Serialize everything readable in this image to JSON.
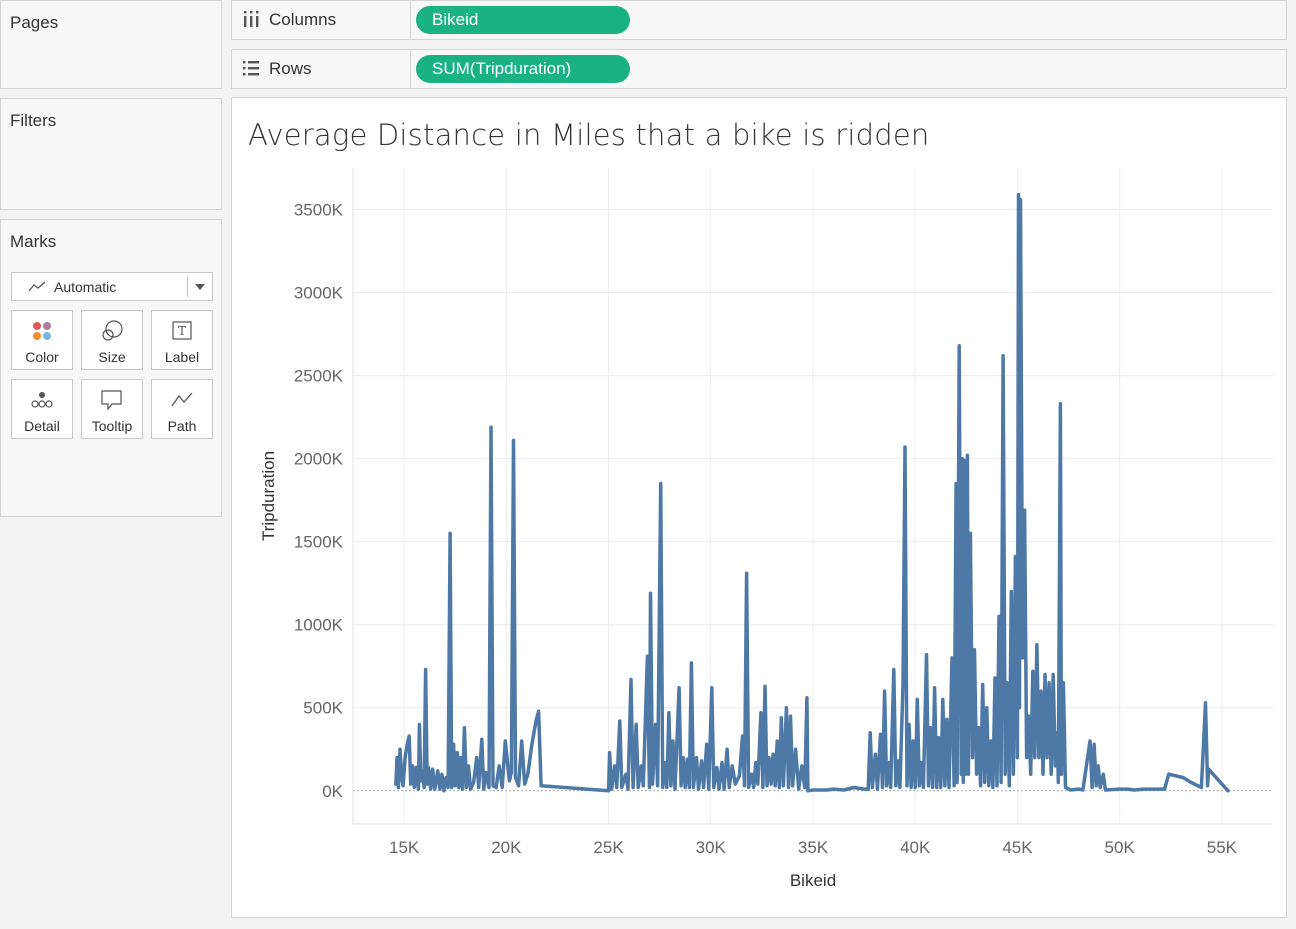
{
  "panels": {
    "pages": {
      "title": "Pages"
    },
    "filters": {
      "title": "Filters"
    },
    "marks": {
      "title": "Marks",
      "mark_type": "Automatic",
      "cards": [
        {
          "label": "Color",
          "icon": "color-icon"
        },
        {
          "label": "Size",
          "icon": "size-icon"
        },
        {
          "label": "Label",
          "icon": "label-icon"
        },
        {
          "label": "Detail",
          "icon": "detail-icon"
        },
        {
          "label": "Tooltip",
          "icon": "tooltip-icon"
        },
        {
          "label": "Path",
          "icon": "path-icon"
        }
      ]
    }
  },
  "shelves": {
    "columns": {
      "label": "Columns",
      "icon": "columns-icon",
      "pill": "Bikeid"
    },
    "rows": {
      "label": "Rows",
      "icon": "rows-icon",
      "pill": "SUM(Tripduration)"
    }
  },
  "colors": {
    "pill": "#1ab283",
    "line": "#4e79a7"
  },
  "chart_data": {
    "type": "line",
    "title": "Average Distance in Miles that a bike is ridden",
    "xlabel": "Bikeid",
    "ylabel": "Tripduration",
    "xlim": [
      12500,
      57500
    ],
    "ylim": [
      -200000,
      3750000
    ],
    "x_ticks": [
      15000,
      20000,
      25000,
      30000,
      35000,
      40000,
      45000,
      50000,
      55000
    ],
    "x_tick_labels": [
      "15K",
      "20K",
      "25K",
      "30K",
      "35K",
      "40K",
      "45K",
      "50K",
      "55K"
    ],
    "y_ticks": [
      0,
      500000,
      1000000,
      1500000,
      2000000,
      2500000,
      3000000,
      3500000
    ],
    "y_tick_labels": [
      "0K",
      "500K",
      "1000K",
      "1500K",
      "2000K",
      "2500K",
      "3000K",
      "3500K"
    ],
    "grid": true,
    "series": [
      {
        "points": [
          [
            14600,
            40000
          ],
          [
            14650,
            200000
          ],
          [
            14720,
            20000
          ],
          [
            14800,
            250000
          ],
          [
            14880,
            80000
          ],
          [
            14950,
            30000
          ],
          [
            15050,
            200000
          ],
          [
            15150,
            280000
          ],
          [
            15250,
            330000
          ],
          [
            15320,
            40000
          ],
          [
            15420,
            150000
          ],
          [
            15500,
            20000
          ],
          [
            15600,
            140000
          ],
          [
            15700,
            10000
          ],
          [
            15750,
            400000
          ],
          [
            15820,
            60000
          ],
          [
            15900,
            120000
          ],
          [
            15980,
            20000
          ],
          [
            16050,
            730000
          ],
          [
            16130,
            40000
          ],
          [
            16200,
            140000
          ],
          [
            16300,
            10000
          ],
          [
            16400,
            130000
          ],
          [
            16500,
            10000
          ],
          [
            16650,
            120000
          ],
          [
            16750,
            10000
          ],
          [
            16850,
            100000
          ],
          [
            16950,
            0
          ],
          [
            17050,
            80000
          ],
          [
            17150,
            20000
          ],
          [
            17250,
            1550000
          ],
          [
            17330,
            20000
          ],
          [
            17420,
            280000
          ],
          [
            17500,
            30000
          ],
          [
            17600,
            230000
          ],
          [
            17680,
            20000
          ],
          [
            17780,
            200000
          ],
          [
            17860,
            10000
          ],
          [
            17950,
            380000
          ],
          [
            18050,
            20000
          ],
          [
            18150,
            150000
          ],
          [
            18250,
            10000
          ],
          [
            18400,
            50000
          ],
          [
            18550,
            200000
          ],
          [
            18650,
            20000
          ],
          [
            18800,
            310000
          ],
          [
            18900,
            10000
          ],
          [
            19000,
            110000
          ],
          [
            19150,
            20000
          ],
          [
            19250,
            2190000
          ],
          [
            19350,
            30000
          ],
          [
            19500,
            20000
          ],
          [
            19650,
            150000
          ],
          [
            19800,
            20000
          ],
          [
            19950,
            300000
          ],
          [
            20150,
            60000
          ],
          [
            20250,
            110000
          ],
          [
            20350,
            2110000
          ],
          [
            20450,
            80000
          ],
          [
            20600,
            30000
          ],
          [
            20750,
            300000
          ],
          [
            20900,
            40000
          ],
          [
            21050,
            100000
          ],
          [
            21250,
            280000
          ],
          [
            21450,
            420000
          ],
          [
            21580,
            480000
          ],
          [
            21700,
            30000
          ],
          [
            25000,
            0
          ],
          [
            25050,
            230000
          ],
          [
            25150,
            10000
          ],
          [
            25300,
            150000
          ],
          [
            25400,
            20000
          ],
          [
            25550,
            420000
          ],
          [
            25650,
            20000
          ],
          [
            25850,
            100000
          ],
          [
            25950,
            10000
          ],
          [
            26100,
            670000
          ],
          [
            26200,
            20000
          ],
          [
            26350,
            400000
          ],
          [
            26450,
            20000
          ],
          [
            26600,
            150000
          ],
          [
            26700,
            30000
          ],
          [
            26900,
            810000
          ],
          [
            27000,
            20000
          ],
          [
            27050,
            1190000
          ],
          [
            27150,
            40000
          ],
          [
            27300,
            400000
          ],
          [
            27400,
            30000
          ],
          [
            27550,
            1850000
          ],
          [
            27650,
            20000
          ],
          [
            27750,
            170000
          ],
          [
            27850,
            20000
          ],
          [
            27950,
            470000
          ],
          [
            28050,
            30000
          ],
          [
            28150,
            300000
          ],
          [
            28250,
            10000
          ],
          [
            28450,
            620000
          ],
          [
            28550,
            30000
          ],
          [
            28650,
            200000
          ],
          [
            28750,
            20000
          ],
          [
            28850,
            190000
          ],
          [
            28950,
            20000
          ],
          [
            29050,
            770000
          ],
          [
            29150,
            20000
          ],
          [
            29300,
            200000
          ],
          [
            29400,
            10000
          ],
          [
            29550,
            180000
          ],
          [
            29650,
            20000
          ],
          [
            29800,
            280000
          ],
          [
            29900,
            10000
          ],
          [
            30050,
            620000
          ],
          [
            30150,
            20000
          ],
          [
            30300,
            140000
          ],
          [
            30400,
            10000
          ],
          [
            30550,
            170000
          ],
          [
            30650,
            10000
          ],
          [
            30800,
            250000
          ],
          [
            30900,
            20000
          ],
          [
            31050,
            150000
          ],
          [
            31200,
            40000
          ],
          [
            31400,
            90000
          ],
          [
            31550,
            330000
          ],
          [
            31650,
            30000
          ],
          [
            31750,
            1310000
          ],
          [
            31850,
            20000
          ],
          [
            32000,
            100000
          ],
          [
            32100,
            20000
          ],
          [
            32200,
            170000
          ],
          [
            32300,
            40000
          ],
          [
            32450,
            470000
          ],
          [
            32550,
            20000
          ],
          [
            32650,
            630000
          ],
          [
            32750,
            30000
          ],
          [
            32850,
            200000
          ],
          [
            32950,
            40000
          ],
          [
            33050,
            220000
          ],
          [
            33150,
            30000
          ],
          [
            33250,
            300000
          ],
          [
            33350,
            20000
          ],
          [
            33450,
            440000
          ],
          [
            33550,
            30000
          ],
          [
            33700,
            500000
          ],
          [
            33800,
            20000
          ],
          [
            33900,
            450000
          ],
          [
            34000,
            30000
          ],
          [
            34150,
            250000
          ],
          [
            34300,
            10000
          ],
          [
            34450,
            150000
          ],
          [
            34600,
            20000
          ],
          [
            34700,
            560000
          ],
          [
            34750,
            0
          ],
          [
            35000,
            5000
          ],
          [
            35700,
            5000
          ],
          [
            36000,
            10000
          ],
          [
            36500,
            5000
          ],
          [
            37000,
            20000
          ],
          [
            37500,
            10000
          ],
          [
            37700,
            10000
          ],
          [
            37800,
            350000
          ],
          [
            37900,
            20000
          ],
          [
            38050,
            220000
          ],
          [
            38150,
            10000
          ],
          [
            38300,
            340000
          ],
          [
            38400,
            20000
          ],
          [
            38500,
            600000
          ],
          [
            38600,
            30000
          ],
          [
            38700,
            170000
          ],
          [
            38800,
            20000
          ],
          [
            38950,
            730000
          ],
          [
            39050,
            30000
          ],
          [
            39150,
            180000
          ],
          [
            39250,
            20000
          ],
          [
            39400,
            640000
          ],
          [
            39500,
            2070000
          ],
          [
            39600,
            30000
          ],
          [
            39700,
            400000
          ],
          [
            39800,
            20000
          ],
          [
            39900,
            300000
          ],
          [
            40000,
            20000
          ],
          [
            40100,
            550000
          ],
          [
            40200,
            30000
          ],
          [
            40300,
            170000
          ],
          [
            40400,
            20000
          ],
          [
            40550,
            820000
          ],
          [
            40650,
            30000
          ],
          [
            40750,
            380000
          ],
          [
            40850,
            20000
          ],
          [
            40950,
            620000
          ],
          [
            41050,
            20000
          ],
          [
            41150,
            320000
          ],
          [
            41250,
            20000
          ],
          [
            41350,
            550000
          ],
          [
            41450,
            30000
          ],
          [
            41550,
            430000
          ],
          [
            41650,
            20000
          ],
          [
            41800,
            800000
          ],
          [
            41900,
            30000
          ],
          [
            42000,
            1850000
          ],
          [
            42050,
            50000
          ],
          [
            42150,
            2680000
          ],
          [
            42250,
            100000
          ],
          [
            42300,
            2000000
          ],
          [
            42350,
            50000
          ],
          [
            42400,
            1990000
          ],
          [
            42450,
            100000
          ],
          [
            42550,
            2020000
          ],
          [
            42600,
            100000
          ],
          [
            42700,
            1550000
          ],
          [
            42800,
            200000
          ],
          [
            42900,
            850000
          ],
          [
            43000,
            100000
          ],
          [
            43100,
            380000
          ],
          [
            43200,
            30000
          ],
          [
            43300,
            640000
          ],
          [
            43400,
            50000
          ],
          [
            43500,
            500000
          ],
          [
            43600,
            30000
          ],
          [
            43700,
            300000
          ],
          [
            43800,
            20000
          ],
          [
            43900,
            680000
          ],
          [
            44000,
            30000
          ],
          [
            44100,
            1050000
          ],
          [
            44200,
            50000
          ],
          [
            44300,
            2620000
          ],
          [
            44400,
            100000
          ],
          [
            44500,
            650000
          ],
          [
            44600,
            30000
          ],
          [
            44700,
            1200000
          ],
          [
            44800,
            100000
          ],
          [
            44900,
            1410000
          ],
          [
            45000,
            200000
          ],
          [
            45050,
            3590000
          ],
          [
            45100,
            500000
          ],
          [
            45150,
            3560000
          ],
          [
            45250,
            800000
          ],
          [
            45350,
            1690000
          ],
          [
            45450,
            200000
          ],
          [
            45550,
            450000
          ],
          [
            45650,
            100000
          ],
          [
            45750,
            720000
          ],
          [
            45850,
            200000
          ],
          [
            45950,
            880000
          ],
          [
            46050,
            200000
          ],
          [
            46150,
            600000
          ],
          [
            46250,
            100000
          ],
          [
            46350,
            700000
          ],
          [
            46450,
            200000
          ],
          [
            46550,
            650000
          ],
          [
            46650,
            100000
          ],
          [
            46750,
            700000
          ],
          [
            46850,
            150000
          ],
          [
            46950,
            350000
          ],
          [
            47000,
            50000
          ],
          [
            47100,
            2330000
          ],
          [
            47150,
            100000
          ],
          [
            47250,
            650000
          ],
          [
            47350,
            20000
          ],
          [
            47500,
            10000
          ],
          [
            47600,
            5000
          ],
          [
            48000,
            10000
          ],
          [
            48200,
            5000
          ],
          [
            48550,
            300000
          ],
          [
            48650,
            20000
          ],
          [
            48750,
            280000
          ],
          [
            48850,
            30000
          ],
          [
            48950,
            150000
          ],
          [
            49050,
            20000
          ],
          [
            49200,
            100000
          ],
          [
            49300,
            5000
          ],
          [
            50000,
            10000
          ],
          [
            50400,
            10000
          ],
          [
            50700,
            5000
          ],
          [
            51200,
            10000
          ],
          [
            52200,
            10000
          ],
          [
            52400,
            100000
          ],
          [
            53100,
            80000
          ],
          [
            53500,
            50000
          ],
          [
            54000,
            20000
          ],
          [
            54200,
            530000
          ],
          [
            54300,
            30000
          ],
          [
            54350,
            130000
          ],
          [
            55300,
            0
          ]
        ]
      }
    ]
  }
}
